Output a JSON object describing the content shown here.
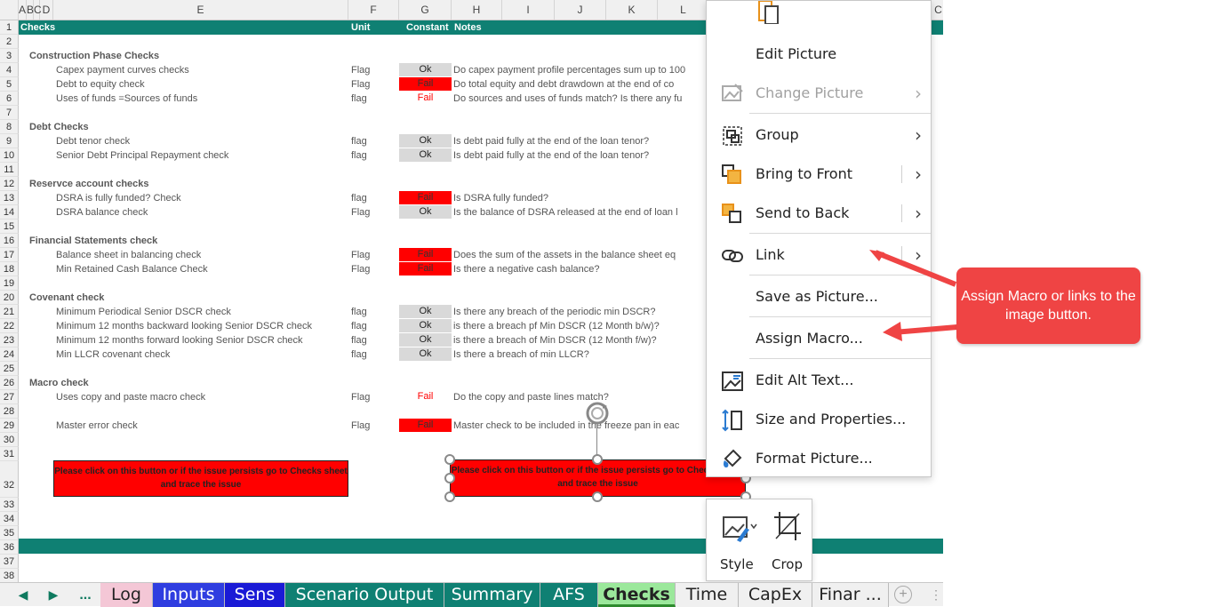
{
  "columns": [
    "A",
    "B",
    "C",
    "D",
    "E",
    "F",
    "G",
    "H",
    "I",
    "J",
    "K",
    "L",
    "C"
  ],
  "header_row": {
    "checks": "Checks",
    "unit": "Unit",
    "constant": "Constant",
    "notes": "Notes"
  },
  "rows": [
    {
      "n": "1"
    },
    {
      "n": "2"
    },
    {
      "n": "3",
      "label": "Construction Phase Checks",
      "section": true
    },
    {
      "n": "4",
      "label": "Capex payment curves checks",
      "unit": "Flag",
      "status": "Ok",
      "style": "ok",
      "note": "Do capex payment profile percentages sum up to 100"
    },
    {
      "n": "5",
      "label": "Debt to equity check",
      "unit": "Flag",
      "status": "Fail",
      "style": "fail",
      "note": "Do total equity and debt drawdown at the end of co"
    },
    {
      "n": "6",
      "label": "Uses of funds =Sources of funds",
      "unit": "flag",
      "status": "Fail",
      "style": "failtxt",
      "note": "Do sources and uses of funds match? Is there any fu"
    },
    {
      "n": "7"
    },
    {
      "n": "8",
      "label": "Debt Checks",
      "section": true
    },
    {
      "n": "9",
      "label": "Debt tenor check",
      "unit": "flag",
      "status": "Ok",
      "style": "ok",
      "note": "Is debt paid fully at the end of the loan tenor?"
    },
    {
      "n": "10",
      "label": "Senior Debt  Principal Repayment  check",
      "unit": "flag",
      "status": "Ok",
      "style": "ok",
      "note": "Is debt paid fully at the end of the loan tenor?"
    },
    {
      "n": "11"
    },
    {
      "n": "12",
      "label": "Reservce account checks",
      "section": true
    },
    {
      "n": "13",
      "label": "DSRA is fully funded? Check",
      "unit": "flag",
      "status": "Fail",
      "style": "fail",
      "note": "Is DSRA fully funded?"
    },
    {
      "n": "14",
      "label": "DSRA balance check",
      "unit": "Flag",
      "status": "Ok",
      "style": "ok",
      "note": "Is the balance of DSRA released at the end of loan l"
    },
    {
      "n": "15"
    },
    {
      "n": "16",
      "label": "Financial Statements check",
      "section": true
    },
    {
      "n": "17",
      "label": "Balance sheet in balancing check",
      "unit": "Flag",
      "status": "Fail",
      "style": "fail",
      "note": "Does the sum of the assets in the balance sheet eq"
    },
    {
      "n": "18",
      "label": "Min Retained Cash Balance Check",
      "unit": "Flag",
      "status": "Fail",
      "style": "fail",
      "note": "Is there a negative cash balance?"
    },
    {
      "n": "19"
    },
    {
      "n": "20",
      "label": "Covenant check",
      "section": true
    },
    {
      "n": "21",
      "label": "Minimum  Periodical Senior DSCR check",
      "unit": "flag",
      "status": "Ok",
      "style": "ok",
      "note": "Is there any breach of the periodic min DSCR?"
    },
    {
      "n": "22",
      "label": "Minimum  12 months backward looking Senior DSCR check",
      "unit": "flag",
      "status": "Ok",
      "style": "ok",
      "note": "is there a breach pf Min DSCR (12 Month b/w)?"
    },
    {
      "n": "23",
      "label": "Minimum  12 months forward looking Senior DSCR check",
      "unit": "flag",
      "status": "Ok",
      "style": "ok",
      "note": "is there a breach of Min DSCR (12 Month f/w)?"
    },
    {
      "n": "24",
      "label": "Min LLCR covenant check",
      "unit": "flag",
      "status": "Ok",
      "style": "ok",
      "note": "Is there a breach of min LLCR?"
    },
    {
      "n": "25"
    },
    {
      "n": "26",
      "label": "Macro check",
      "section": true
    },
    {
      "n": "27",
      "label": " Uses copy and paste macro check",
      "unit": "Flag",
      "status": "Fail",
      "style": "failtxt",
      "note": "Do the copy and paste lines match?"
    },
    {
      "n": "28"
    },
    {
      "n": "29",
      "label": "Master error check",
      "unit": "Flag",
      "status": "Fail",
      "style": "fail",
      "note": "Master check to be included in the freeze pan in eac"
    },
    {
      "n": "30"
    },
    {
      "n": "31"
    },
    {
      "n": "32"
    },
    {
      "n": "33"
    },
    {
      "n": "34"
    },
    {
      "n": "35"
    },
    {
      "n": "36"
    },
    {
      "n": "37"
    },
    {
      "n": "38"
    }
  ],
  "buttons": {
    "left": "Please click on this button or if the issue persists go to Checks sheet and trace the issue",
    "selected": "Please click on this button or if the issue persists go to Checks sheet and trace the issue"
  },
  "context_menu": {
    "items": [
      {
        "label": "Edit Picture",
        "icon": "edit-picture-icon",
        "enabled": true,
        "submenu": false
      },
      {
        "label": "Change Picture",
        "icon": "change-picture-icon",
        "enabled": false,
        "submenu": true
      },
      {
        "label": "Group",
        "icon": "group-icon",
        "enabled": true,
        "submenu": true
      },
      {
        "label": "Bring to Front",
        "icon": "bring-to-front-icon",
        "enabled": true,
        "submenu": true,
        "split": true
      },
      {
        "label": "Send to Back",
        "icon": "send-to-back-icon",
        "enabled": true,
        "submenu": true,
        "split": true
      },
      {
        "label": "Link",
        "icon": "link-icon",
        "enabled": true,
        "submenu": true,
        "split": true
      },
      {
        "label": "Save as Picture...",
        "icon": "",
        "enabled": true,
        "submenu": false
      },
      {
        "label": "Assign Macro...",
        "icon": "",
        "enabled": true,
        "submenu": false
      },
      {
        "label": "Edit Alt Text...",
        "icon": "alt-text-icon",
        "enabled": true,
        "submenu": false
      },
      {
        "label": "Size and Properties...",
        "icon": "size-properties-icon",
        "enabled": true,
        "submenu": false
      },
      {
        "label": "Format Picture...",
        "icon": "format-picture-icon",
        "enabled": true,
        "submenu": false
      }
    ]
  },
  "mini_toolbar": {
    "style": "Style",
    "crop": "Crop"
  },
  "callout": {
    "text": "Assign Macro or links to the image button."
  },
  "sheet_tabs": [
    {
      "label": "Log",
      "bg": "#f4c7d6",
      "fg": "#222222"
    },
    {
      "label": "Inputs",
      "bg": "#2f3de0",
      "fg": "#ffffff"
    },
    {
      "label": "Sens",
      "bg": "#1a1ad6",
      "fg": "#ffffff"
    },
    {
      "label": "Scenario Output",
      "bg": "#0f8073",
      "fg": "#ffffff"
    },
    {
      "label": "Summary",
      "bg": "#0f8073",
      "fg": "#ffffff"
    },
    {
      "label": "AFS",
      "bg": "#0f8073",
      "fg": "#ffffff"
    },
    {
      "label": "Checks",
      "bg": "#9be89b",
      "fg": "#222222",
      "active": true
    },
    {
      "label": "Time",
      "bg": "#f0f0f0",
      "fg": "#222222"
    },
    {
      "label": "CapEx",
      "bg": "#f0f0f0",
      "fg": "#222222"
    },
    {
      "label": "Finar ...",
      "bg": "#f0f0f0",
      "fg": "#222222"
    }
  ],
  "colors": {
    "teal": "#0f8073",
    "fail": "#ff0000",
    "ok": "#d9d9d9",
    "callout": "#ef4444"
  }
}
